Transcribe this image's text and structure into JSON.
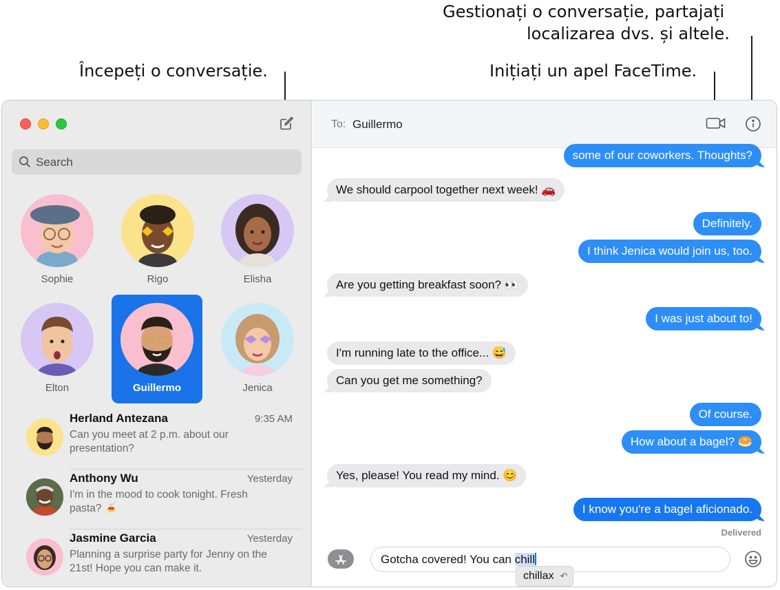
{
  "callouts": {
    "manage_line1": "Gestionați o conversație, partajați",
    "manage_line2": "localizarea dvs. și altele.",
    "facetime": "Inițiați un apel FaceTime.",
    "start": "Începeți o conversație."
  },
  "search": {
    "placeholder": "Search"
  },
  "pins": [
    {
      "name": "Sophie",
      "color": "#f9bfcf"
    },
    {
      "name": "Rigo",
      "color": "#fae38a"
    },
    {
      "name": "Elisha",
      "color": "#d6c7f5"
    },
    {
      "name": "Elton",
      "color": "#d6c7f5"
    },
    {
      "name": "Guillermo",
      "color": "#f9bfcf",
      "selected": true
    },
    {
      "name": "Jenica",
      "color": "#c8eaf6"
    }
  ],
  "conversations": [
    {
      "name": "Herland Antezana",
      "time": "9:35 AM",
      "preview": "Can you meet at 2 p.m. about our presentation?",
      "avatar_color": "#fae38a"
    },
    {
      "name": "Anthony Wu",
      "time": "Yesterday",
      "preview": "I'm in the mood to cook tonight. Fresh pasta? 🍝",
      "avatar_color": "#7c8a6a"
    },
    {
      "name": "Jasmine Garcia",
      "time": "Yesterday",
      "preview": "Planning a surprise party for Jenny on the 21st! Hope you can make it.",
      "avatar_color": "#f9bfcf"
    }
  ],
  "header": {
    "to_label": "To:",
    "recipient": "Guillermo"
  },
  "messages": [
    {
      "dir": "out",
      "text": "some of our coworkers. Thoughts?"
    },
    {
      "dir": "in",
      "text": "We should carpool together next week! 🚗"
    },
    {
      "dir": "out",
      "text": "Definitely."
    },
    {
      "dir": "out",
      "text": "I think Jenica would join us, too."
    },
    {
      "dir": "in",
      "text": "Are you getting breakfast soon? 👀"
    },
    {
      "dir": "out",
      "text": "I was just about to!"
    },
    {
      "dir": "in",
      "text": "I'm running late to the office... 😅"
    },
    {
      "dir": "in",
      "text": "Can you get me something?"
    },
    {
      "dir": "out",
      "text": "Of course."
    },
    {
      "dir": "out",
      "text": "How about a bagel? 🥯"
    },
    {
      "dir": "in",
      "text": "Yes, please! You read my mind. 😊"
    },
    {
      "dir": "out",
      "text": "I know you're a bagel aficionado."
    }
  ],
  "status": {
    "delivered": "Delivered"
  },
  "composer": {
    "typed": "Gotcha covered! You can ",
    "highlighted": "chill",
    "suggestion": "chillax",
    "suggestion_undo": "↶"
  },
  "colors": {
    "accent": "#1a73e8",
    "outgoing": "#2d8ef7",
    "incoming": "#e9e9eb"
  }
}
